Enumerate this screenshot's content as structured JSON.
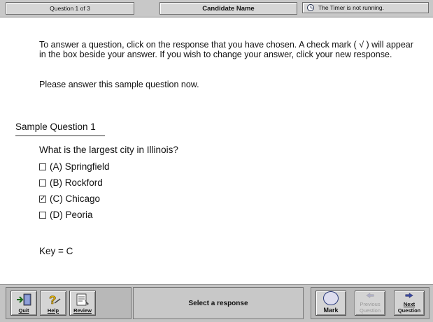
{
  "topbar": {
    "question_counter": "Question 1 of 3",
    "candidate_name": "Candidate Name",
    "timer_text": "The Timer is not running."
  },
  "instructions": {
    "text": "To answer a question, click on the response that you have chosen. A check mark ( √ ) will appear in the box beside your answer. If you wish to change your answer, click your new response.",
    "prompt": "Please answer this sample question now."
  },
  "question": {
    "title": "Sample Question 1",
    "stem": "What is the largest city in Illinois?",
    "options": [
      {
        "letter": "(A)",
        "text": "Springfield",
        "checked": false
      },
      {
        "letter": "(B)",
        "text": "Rockford",
        "checked": false
      },
      {
        "letter": "(C)",
        "text": "Chicago",
        "checked": true
      },
      {
        "letter": "(D)",
        "text": "Peoria",
        "checked": false
      }
    ],
    "key": "Key = C"
  },
  "toolbar": {
    "quit_label": "Quit",
    "help_label": "Help",
    "review_label": "Review",
    "status_text": "Select a response",
    "mark_label": "Mark",
    "previous_label_1": "Previous",
    "previous_label_2": "Question",
    "next_label_1": "Next",
    "next_label_2": "Question"
  },
  "colors": {
    "bar_gray": "#c4c4c4",
    "accent_blue": "#2a3a7a",
    "check_green": "#1a7a1a"
  }
}
